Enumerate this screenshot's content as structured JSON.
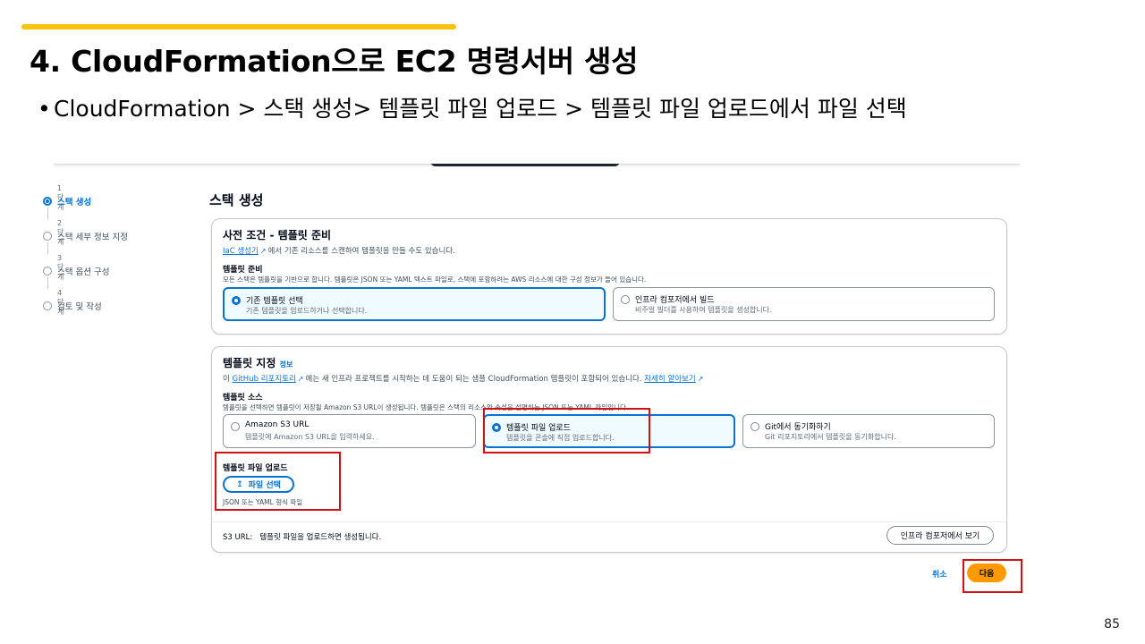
{
  "slide": {
    "title": "4. CloudFormation으로 EC2 명령서버 생성",
    "bullet": "CloudFormation > 스택 생성> 템플릿 파일 업로드 > 템플릿 파일 업로드에서 파일 선택",
    "page_number": "85",
    "accent_color": "#f6c40f",
    "highlight_color": "#d21010"
  },
  "steps": [
    {
      "label": "1단계",
      "name": "스택 생성",
      "active": true
    },
    {
      "label": "2단계",
      "name": "스택 세부 정보 지정",
      "active": false
    },
    {
      "label": "3단계",
      "name": "스택 옵션 구성",
      "active": false
    },
    {
      "label": "4단계",
      "name": "검토 및 작성",
      "active": false
    }
  ],
  "page_heading": "스택 생성",
  "prereq": {
    "title": "사전 조건 - 템플릿 준비",
    "iac_link": "IaC 생성기",
    "iac_text": "에서 기존 리소스를 스캔하여 템플릿을 만들 수도 있습니다.",
    "field_label": "템플릿 준비",
    "field_desc": "모든 스택은 템플릿을 기반으로 합니다. 템플릿은 JSON 또는 YAML 텍스트 파일로, 스택에 포함하려는 AWS 리소스에 대한 구성 정보가 들어 있습니다.",
    "options": [
      {
        "title": "기존 템플릿 선택",
        "desc": "기존 템플릿을 업로드하거나 선택합니다.",
        "selected": true
      },
      {
        "title": "인프라 컴포저에서 빌드",
        "desc": "비주얼 빌더를 사용하여 템플릿을 생성합니다.",
        "selected": false
      }
    ]
  },
  "template": {
    "title": "템플릿 지정",
    "info": "정보",
    "github_prefix": "이",
    "github_link": "GitHub 리포지토리",
    "github_text": "에는 새 인프라 프로젝트를 시작하는 데 도움이 되는 샘플 CloudFormation 템플릿이 포함되어 있습니다.",
    "learn_more": "자세히 알아보기",
    "source_label": "템플릿 소스",
    "source_desc": "템플릿을 선택하면 템플릿이 저장될 Amazon S3 URL이 생성됩니다. 템플릿은 스택의 리소스와 속성을 설명하는 JSON 또는 YAML 파일입니다.",
    "sources": [
      {
        "title": "Amazon S3 URL",
        "desc": "템플릿에 Amazon S3 URL을 입력하세요.",
        "selected": false
      },
      {
        "title": "템플릿 파일 업로드",
        "desc": "템플릿을 콘솔에 직접 업로드합니다.",
        "selected": true
      },
      {
        "title": "Git에서 동기화하기",
        "desc": "Git 리포지토리에서 템플릿을 동기화합니다.",
        "selected": false
      }
    ],
    "upload_label": "템플릿 파일 업로드",
    "choose_file": "파일 선택",
    "file_hint": "JSON 또는 YAML 형식 파일",
    "s3_url_label": "S3 URL:",
    "s3_url_value": "템플릿 파일을 업로드하면 생성됩니다.",
    "view_button": "인프라 컴포저에서 보기"
  },
  "footer": {
    "cancel": "취소",
    "next": "다음"
  }
}
